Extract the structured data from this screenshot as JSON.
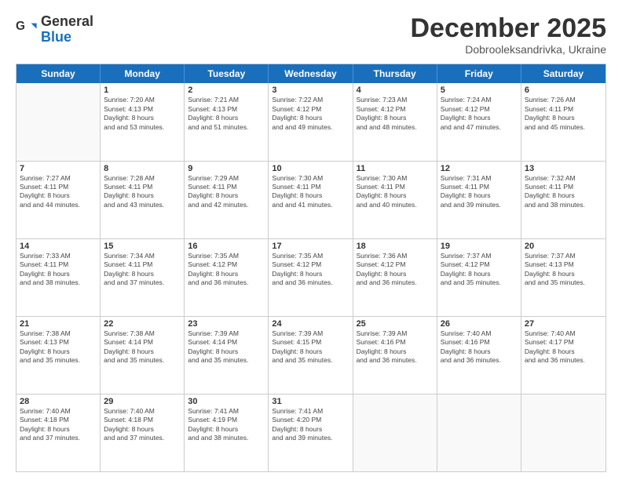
{
  "logo": {
    "general": "General",
    "blue": "Blue"
  },
  "header": {
    "month": "December 2025",
    "location": "Dobrooleksandrivka, Ukraine"
  },
  "weekdays": [
    "Sunday",
    "Monday",
    "Tuesday",
    "Wednesday",
    "Thursday",
    "Friday",
    "Saturday"
  ],
  "weeks": [
    [
      {
        "day": "",
        "sunrise": "",
        "sunset": "",
        "daylight": ""
      },
      {
        "day": "1",
        "sunrise": "Sunrise: 7:20 AM",
        "sunset": "Sunset: 4:13 PM",
        "daylight": "Daylight: 8 hours and 53 minutes."
      },
      {
        "day": "2",
        "sunrise": "Sunrise: 7:21 AM",
        "sunset": "Sunset: 4:13 PM",
        "daylight": "Daylight: 8 hours and 51 minutes."
      },
      {
        "day": "3",
        "sunrise": "Sunrise: 7:22 AM",
        "sunset": "Sunset: 4:12 PM",
        "daylight": "Daylight: 8 hours and 49 minutes."
      },
      {
        "day": "4",
        "sunrise": "Sunrise: 7:23 AM",
        "sunset": "Sunset: 4:12 PM",
        "daylight": "Daylight: 8 hours and 48 minutes."
      },
      {
        "day": "5",
        "sunrise": "Sunrise: 7:24 AM",
        "sunset": "Sunset: 4:12 PM",
        "daylight": "Daylight: 8 hours and 47 minutes."
      },
      {
        "day": "6",
        "sunrise": "Sunrise: 7:26 AM",
        "sunset": "Sunset: 4:11 PM",
        "daylight": "Daylight: 8 hours and 45 minutes."
      }
    ],
    [
      {
        "day": "7",
        "sunrise": "Sunrise: 7:27 AM",
        "sunset": "Sunset: 4:11 PM",
        "daylight": "Daylight: 8 hours and 44 minutes."
      },
      {
        "day": "8",
        "sunrise": "Sunrise: 7:28 AM",
        "sunset": "Sunset: 4:11 PM",
        "daylight": "Daylight: 8 hours and 43 minutes."
      },
      {
        "day": "9",
        "sunrise": "Sunrise: 7:29 AM",
        "sunset": "Sunset: 4:11 PM",
        "daylight": "Daylight: 8 hours and 42 minutes."
      },
      {
        "day": "10",
        "sunrise": "Sunrise: 7:30 AM",
        "sunset": "Sunset: 4:11 PM",
        "daylight": "Daylight: 8 hours and 41 minutes."
      },
      {
        "day": "11",
        "sunrise": "Sunrise: 7:30 AM",
        "sunset": "Sunset: 4:11 PM",
        "daylight": "Daylight: 8 hours and 40 minutes."
      },
      {
        "day": "12",
        "sunrise": "Sunrise: 7:31 AM",
        "sunset": "Sunset: 4:11 PM",
        "daylight": "Daylight: 8 hours and 39 minutes."
      },
      {
        "day": "13",
        "sunrise": "Sunrise: 7:32 AM",
        "sunset": "Sunset: 4:11 PM",
        "daylight": "Daylight: 8 hours and 38 minutes."
      }
    ],
    [
      {
        "day": "14",
        "sunrise": "Sunrise: 7:33 AM",
        "sunset": "Sunset: 4:11 PM",
        "daylight": "Daylight: 8 hours and 38 minutes."
      },
      {
        "day": "15",
        "sunrise": "Sunrise: 7:34 AM",
        "sunset": "Sunset: 4:11 PM",
        "daylight": "Daylight: 8 hours and 37 minutes."
      },
      {
        "day": "16",
        "sunrise": "Sunrise: 7:35 AM",
        "sunset": "Sunset: 4:12 PM",
        "daylight": "Daylight: 8 hours and 36 minutes."
      },
      {
        "day": "17",
        "sunrise": "Sunrise: 7:35 AM",
        "sunset": "Sunset: 4:12 PM",
        "daylight": "Daylight: 8 hours and 36 minutes."
      },
      {
        "day": "18",
        "sunrise": "Sunrise: 7:36 AM",
        "sunset": "Sunset: 4:12 PM",
        "daylight": "Daylight: 8 hours and 36 minutes."
      },
      {
        "day": "19",
        "sunrise": "Sunrise: 7:37 AM",
        "sunset": "Sunset: 4:12 PM",
        "daylight": "Daylight: 8 hours and 35 minutes."
      },
      {
        "day": "20",
        "sunrise": "Sunrise: 7:37 AM",
        "sunset": "Sunset: 4:13 PM",
        "daylight": "Daylight: 8 hours and 35 minutes."
      }
    ],
    [
      {
        "day": "21",
        "sunrise": "Sunrise: 7:38 AM",
        "sunset": "Sunset: 4:13 PM",
        "daylight": "Daylight: 8 hours and 35 minutes."
      },
      {
        "day": "22",
        "sunrise": "Sunrise: 7:38 AM",
        "sunset": "Sunset: 4:14 PM",
        "daylight": "Daylight: 8 hours and 35 minutes."
      },
      {
        "day": "23",
        "sunrise": "Sunrise: 7:39 AM",
        "sunset": "Sunset: 4:14 PM",
        "daylight": "Daylight: 8 hours and 35 minutes."
      },
      {
        "day": "24",
        "sunrise": "Sunrise: 7:39 AM",
        "sunset": "Sunset: 4:15 PM",
        "daylight": "Daylight: 8 hours and 35 minutes."
      },
      {
        "day": "25",
        "sunrise": "Sunrise: 7:39 AM",
        "sunset": "Sunset: 4:16 PM",
        "daylight": "Daylight: 8 hours and 36 minutes."
      },
      {
        "day": "26",
        "sunrise": "Sunrise: 7:40 AM",
        "sunset": "Sunset: 4:16 PM",
        "daylight": "Daylight: 8 hours and 36 minutes."
      },
      {
        "day": "27",
        "sunrise": "Sunrise: 7:40 AM",
        "sunset": "Sunset: 4:17 PM",
        "daylight": "Daylight: 8 hours and 36 minutes."
      }
    ],
    [
      {
        "day": "28",
        "sunrise": "Sunrise: 7:40 AM",
        "sunset": "Sunset: 4:18 PM",
        "daylight": "Daylight: 8 hours and 37 minutes."
      },
      {
        "day": "29",
        "sunrise": "Sunrise: 7:40 AM",
        "sunset": "Sunset: 4:18 PM",
        "daylight": "Daylight: 8 hours and 37 minutes."
      },
      {
        "day": "30",
        "sunrise": "Sunrise: 7:41 AM",
        "sunset": "Sunset: 4:19 PM",
        "daylight": "Daylight: 8 hours and 38 minutes."
      },
      {
        "day": "31",
        "sunrise": "Sunrise: 7:41 AM",
        "sunset": "Sunset: 4:20 PM",
        "daylight": "Daylight: 8 hours and 39 minutes."
      },
      {
        "day": "",
        "sunrise": "",
        "sunset": "",
        "daylight": ""
      },
      {
        "day": "",
        "sunrise": "",
        "sunset": "",
        "daylight": ""
      },
      {
        "day": "",
        "sunrise": "",
        "sunset": "",
        "daylight": ""
      }
    ]
  ]
}
